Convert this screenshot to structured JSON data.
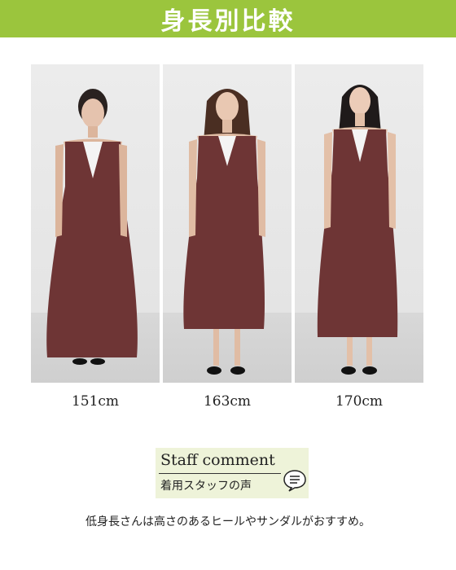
{
  "header": {
    "title": "身長別比較"
  },
  "colors": {
    "brand": "#9bc53d",
    "staff_bg": "#eef3d9",
    "dress": "#6e3535"
  },
  "models": [
    {
      "height_label": "151cm"
    },
    {
      "height_label": "163cm"
    },
    {
      "height_label": "170cm"
    }
  ],
  "staff": {
    "title_en": "Staff comment",
    "title_jp": "着用スタッフの声",
    "icon": "speech-bubble-icon"
  },
  "comment": {
    "text": "低身長さんは高さのあるヒールやサンダルがおすすめ。"
  }
}
